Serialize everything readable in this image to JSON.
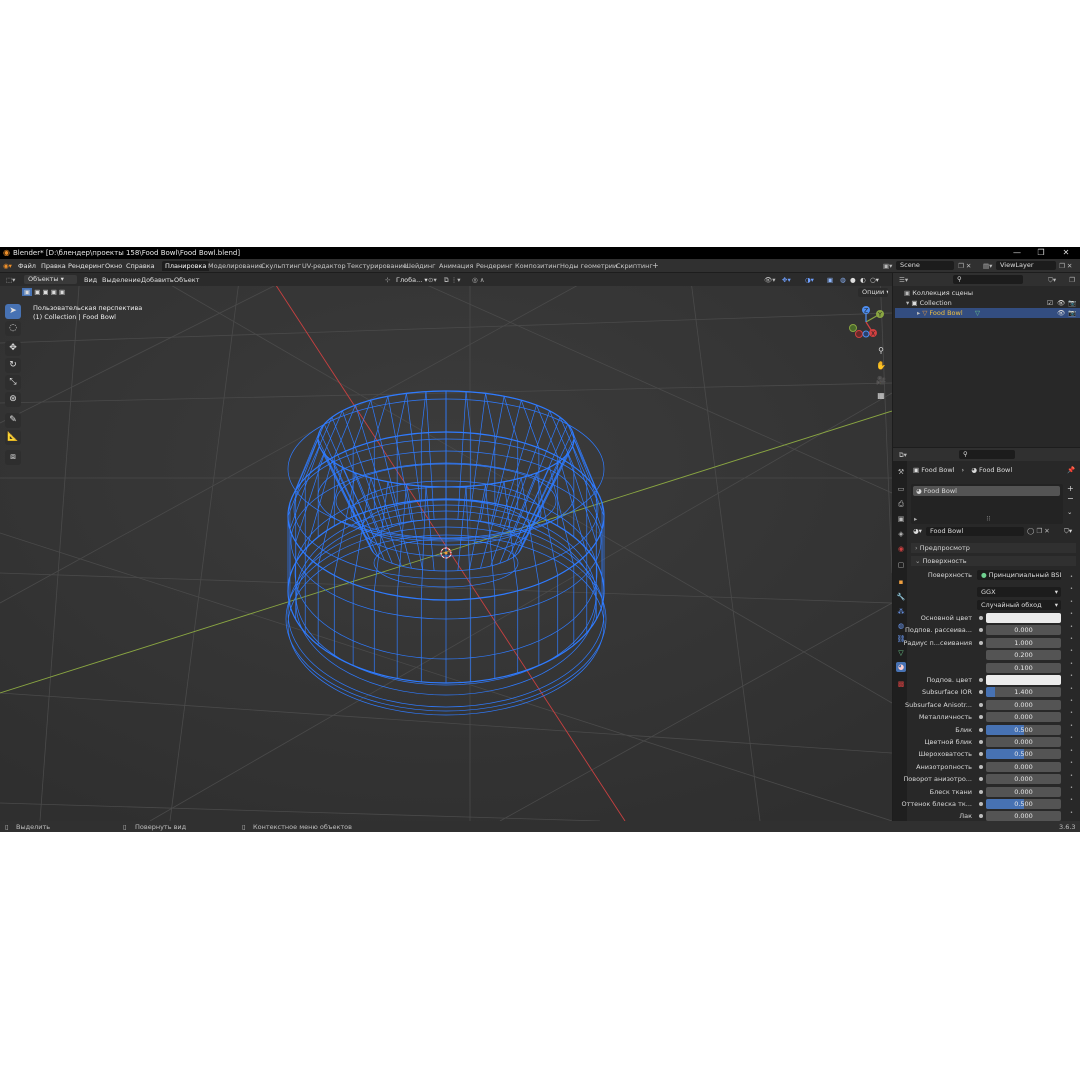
{
  "window": {
    "title": "Blender* [D:\\блендер\\проекты 158\\Food Bowl\\Food Bowl.blend]",
    "min": "—",
    "max": "❐",
    "close": "✕"
  },
  "menu": {
    "items": [
      "Файл",
      "Правка",
      "Рендеринг",
      "Окно",
      "Справка"
    ],
    "workspaces": [
      "Планировка",
      "Моделирование",
      "Скульптинг",
      "UV-редактор",
      "Текстурирование",
      "Шейдинг",
      "Анимация",
      "Рендеринг",
      "Композитинг",
      "Ноды геометрии",
      "Скриптинг",
      "+"
    ],
    "scene": "Scene",
    "view_layer": "ViewLayer"
  },
  "viewport": {
    "mode": "Объекты",
    "menus": [
      "Вид",
      "Выделение",
      "Добавить",
      "Объект"
    ],
    "orientation": "Глоба...",
    "options": "Опции",
    "overlay_title": "Пользовательская перспектива",
    "overlay_subtitle": "(1) Collection | Food Bowl",
    "gizmo": {
      "x": "X",
      "y": "Y",
      "z": "Z"
    }
  },
  "outliner": {
    "root": "Коллекция сцены",
    "collection": "Collection",
    "object": "Food Bowl"
  },
  "properties": {
    "breadcrumb_object": "Food Bowl",
    "breadcrumb_material": "Food Bowl",
    "slot": "Food Bowl",
    "material_name": "Food Bowl",
    "section_preview": "Предпросмотр",
    "section_surface": "Поверхность",
    "surface_label": "Поверхность",
    "surface_value": "Принципиальный BSDF",
    "distribution": "GGX",
    "subsurface_method": "Случайный обход",
    "rows": [
      {
        "label": "Основной цвет",
        "kind": "color"
      },
      {
        "label": "Подпов. рассеива...",
        "kind": "value",
        "value": "0.000",
        "fill": 0
      },
      {
        "label": "Радиус п...сеивания",
        "kind": "value",
        "value": "1.000",
        "fill": 0
      },
      {
        "label": "",
        "kind": "value",
        "value": "0.200",
        "fill": 0
      },
      {
        "label": "",
        "kind": "value",
        "value": "0.100",
        "fill": 0
      },
      {
        "label": "Подпов. цвет",
        "kind": "color"
      },
      {
        "label": "Subsurface IOR",
        "kind": "value",
        "value": "1.400",
        "fill": 0.12
      },
      {
        "label": "Subsurface Anisotr...",
        "kind": "value",
        "value": "0.000",
        "fill": 0
      },
      {
        "label": "Металличность",
        "kind": "value",
        "value": "0.000",
        "fill": 0
      },
      {
        "label": "Блик",
        "kind": "value",
        "value": "0.500",
        "fill": 0.5
      },
      {
        "label": "Цветной блик",
        "kind": "value",
        "value": "0.000",
        "fill": 0
      },
      {
        "label": "Шероховатость",
        "kind": "value",
        "value": "0.500",
        "fill": 0.5
      },
      {
        "label": "Анизотропность",
        "kind": "value",
        "value": "0.000",
        "fill": 0
      },
      {
        "label": "Поворот анизотро...",
        "kind": "value",
        "value": "0.000",
        "fill": 0
      },
      {
        "label": "Блеск ткани",
        "kind": "value",
        "value": "0.000",
        "fill": 0
      },
      {
        "label": "Оттенок блеска тк...",
        "kind": "value",
        "value": "0.500",
        "fill": 0.5
      },
      {
        "label": "Лак",
        "kind": "value",
        "value": "0.000",
        "fill": 0
      }
    ]
  },
  "statusbar": {
    "select": "Выделить",
    "rotate": "Повернуть вид",
    "context": "Контекстное меню объектов",
    "version": "3.6.3"
  },
  "colors": {
    "accent": "#4772b3",
    "wire": "#2f7bff",
    "x_axis": "#d04040",
    "y_axis": "#7da83a"
  }
}
